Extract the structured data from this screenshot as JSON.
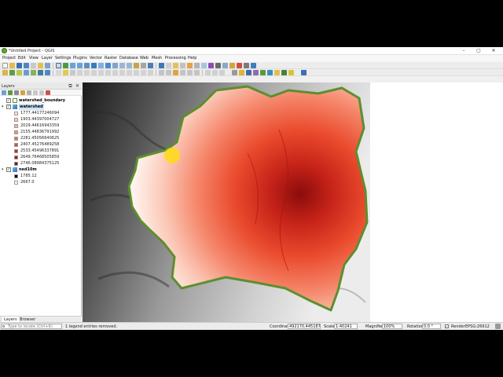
{
  "window": {
    "title": "*Untitled Project - QGIS",
    "controls": {
      "minimize": "–",
      "maximize": "▢",
      "close": "✕"
    }
  },
  "menu": [
    "Project",
    "Edit",
    "View",
    "Layer",
    "Settings",
    "Plugins",
    "Vector",
    "Raster",
    "Database",
    "Web",
    "Mesh",
    "Processing",
    "Help"
  ],
  "layers_panel": {
    "title": "Layers",
    "float_button": "⧉",
    "close_button": "✕",
    "layers": [
      {
        "name": "watershed_boundary",
        "checked": "✓",
        "chevron": "",
        "icon": "polygon-layer-icon"
      },
      {
        "name": "watershed",
        "checked": "✓",
        "chevron": "▾",
        "icon": "raster-layer-icon",
        "selected": true
      },
      {
        "name": "ned10m",
        "checked": "✓",
        "chevron": "▾",
        "icon": "raster-layer-icon"
      }
    ],
    "watershed_legend": [
      {
        "label": "1777.44177246094",
        "color": "#fbe2d9"
      },
      {
        "label": "1903.44397004727",
        "color": "#f9cdbd"
      },
      {
        "label": "2029.44616943359",
        "color": "#f7b19a"
      },
      {
        "label": "2155.44836791992",
        "color": "#f39273"
      },
      {
        "label": "2281.45056640625",
        "color": "#ef6e4d"
      },
      {
        "label": "2407.45276489258",
        "color": "#e24a32"
      },
      {
        "label": "2533.45496337891",
        "color": "#c6281f"
      },
      {
        "label": "2649.76468505859",
        "color": "#a21717"
      },
      {
        "label": "2746.08984375125",
        "color": "#7a0d0d"
      }
    ],
    "ned10m_legend": [
      {
        "label": "1785.12",
        "color": "#000000"
      },
      {
        "label": "2667.0",
        "color": "#ffffff"
      }
    ],
    "tabs": [
      "Layers",
      "Browser"
    ]
  },
  "statusbar": {
    "locator_placeholder": "Type to locate (Ctrl+K)",
    "message": "1 legend entries removed.",
    "coordinate_label": "Coordinate",
    "coordinate_value": "492170,4451873",
    "scale_label": "Scale",
    "scale_value": "1:40241",
    "magnifier_label": "Magnifier",
    "magnifier_value": "100%",
    "rotation_label": "Rotation",
    "rotation_value": "0.0 °",
    "render_label": "Render",
    "render_checked": "✓",
    "crs": "EPSG:26912"
  }
}
